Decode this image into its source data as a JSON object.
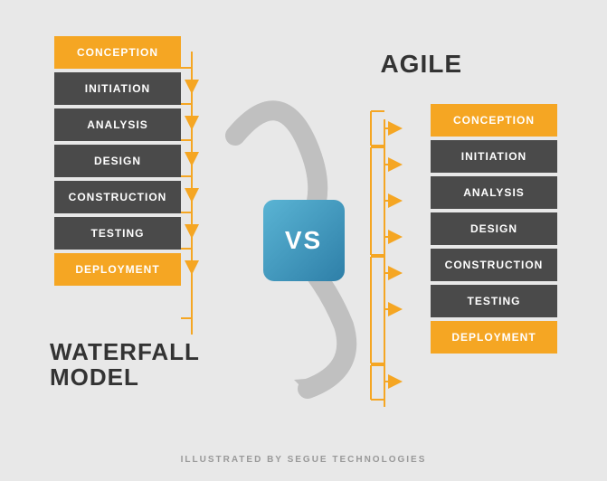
{
  "titles": {
    "waterfall": "WATERFALL\nMODEL",
    "agile": "AGILE",
    "vs": "VS",
    "footer": "ILLUSTRATED BY SEGUE TECHNOLOGIES"
  },
  "waterfall_steps": [
    {
      "label": "CONCEPTION",
      "type": "orange"
    },
    {
      "label": "INITIATION",
      "type": "dark"
    },
    {
      "label": "ANALYSIS",
      "type": "dark"
    },
    {
      "label": "DESIGN",
      "type": "dark"
    },
    {
      "label": "CONSTRUCTION",
      "type": "dark"
    },
    {
      "label": "TESTING",
      "type": "dark"
    },
    {
      "label": "DEPLOYMENT",
      "type": "orange"
    }
  ],
  "agile_steps": [
    {
      "label": "CONCEPTION",
      "type": "orange"
    },
    {
      "label": "INITIATION",
      "type": "dark"
    },
    {
      "label": "ANALYSIS",
      "type": "dark"
    },
    {
      "label": "DESIGN",
      "type": "dark"
    },
    {
      "label": "CONSTRUCTION",
      "type": "dark"
    },
    {
      "label": "TESTING",
      "type": "dark"
    },
    {
      "label": "DEPLOYMENT",
      "type": "orange"
    }
  ]
}
